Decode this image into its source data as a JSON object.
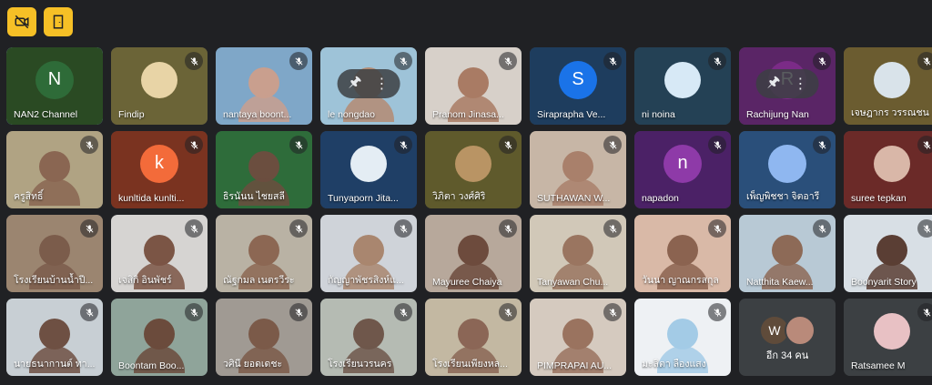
{
  "toolbar": {
    "buttons": [
      {
        "icon": "camera-off-icon",
        "color": "#f6c026"
      },
      {
        "icon": "leave-room-icon",
        "color": "#f6c026"
      }
    ]
  },
  "participants": [
    {
      "name": "NAN2 Channel",
      "type": "avatar",
      "initial": "N",
      "avatar_color": "#2e6b38",
      "bg": "#2a4a23",
      "mic": "on",
      "active": true
    },
    {
      "name": "Findip",
      "type": "avatar-img",
      "avatar_color": "#e8d4a6",
      "bg": "#6b6437",
      "mic": "muted"
    },
    {
      "name": "nantaya boont...",
      "type": "video",
      "bg": "#7fa7c8",
      "person": "#c99f8e",
      "mic": "muted"
    },
    {
      "name": "le nongdao",
      "type": "video",
      "bg": "#9ec3d8",
      "person": "#b48b73",
      "mic": "muted",
      "hover": true
    },
    {
      "name": "Pranom Jinasa...",
      "type": "video",
      "bg": "#d7d0c9",
      "person": "#a97b64",
      "mic": "muted"
    },
    {
      "name": "Siraprapha Ve...",
      "type": "avatar",
      "initial": "S",
      "avatar_color": "#1a73e8",
      "bg": "#1e3d5e",
      "mic": "muted"
    },
    {
      "name": "ni noina",
      "type": "avatar-img",
      "avatar_color": "#d7e9f6",
      "bg": "#244155",
      "mic": "muted"
    },
    {
      "name": "Rachijung Nan",
      "type": "avatar",
      "initial": "R",
      "avatar_color": "#7b2b87",
      "bg": "#5a2566",
      "mic": "muted",
      "hover": true
    },
    {
      "name": "เจษฎากร วรรณชน",
      "type": "avatar-img",
      "avatar_color": "#d9e3ea",
      "bg": "#6b5c30",
      "mic": "muted"
    },
    {
      "name": "ครูสิทธิ์",
      "type": "video",
      "bg": "#b0a383",
      "person": "#8a6652",
      "mic": "muted"
    },
    {
      "name": "kunltida kunlti...",
      "type": "avatar",
      "initial": "k",
      "avatar_color": "#f36b3a",
      "bg": "#7a3320",
      "mic": "muted"
    },
    {
      "name": "ธิรนันน ไชยสลี",
      "type": "video",
      "bg": "#2e6c3a",
      "person": "#6b4e3f",
      "mic": "muted"
    },
    {
      "name": "Tunyaporn Jita...",
      "type": "avatar-img",
      "avatar_color": "#e4edf4",
      "bg": "#1f3f66",
      "mic": "muted"
    },
    {
      "name": "วิภิตา วงศ์ศิริ",
      "type": "avatar-img",
      "avatar_color": "#b99464",
      "bg": "#5f5a2c",
      "mic": "muted"
    },
    {
      "name": "SUTHAWAN W...",
      "type": "video",
      "bg": "#c7b6a6",
      "person": "#a9806b",
      "mic": "muted"
    },
    {
      "name": "napadon",
      "type": "avatar",
      "initial": "n",
      "avatar_color": "#8e3aa8",
      "bg": "#4b2166",
      "mic": "muted"
    },
    {
      "name": "เพ็ญพิชชา จิตอารี",
      "type": "avatar",
      "initial": "",
      "avatar_color": "#8fb7f0",
      "bg": "#2a4f7a",
      "mic": "muted"
    },
    {
      "name": "suree tepkan",
      "type": "avatar-img",
      "avatar_color": "#d9b7a8",
      "bg": "#6b2a28",
      "mic": "muted"
    },
    {
      "name": "โรงเรียนบ้านน้ำปี...",
      "type": "video",
      "bg": "#9b8570",
      "person": "#7b5c4b",
      "mic": "muted"
    },
    {
      "name": "เจสิกิ อินพัชร์",
      "type": "video",
      "bg": "#d6d4d2",
      "person": "#7b5545",
      "mic": "muted"
    },
    {
      "name": "ณัฐกมล เนตรวีระ",
      "type": "video",
      "bg": "#b9b2a4",
      "person": "#8c6753",
      "mic": "muted"
    },
    {
      "name": "กัญญาพัชรสิงห์แ...",
      "type": "video",
      "bg": "#cfd3d9",
      "person": "#a9866f",
      "mic": "muted"
    },
    {
      "name": "Mayuree Chaiya",
      "type": "video",
      "bg": "#b7a89b",
      "person": "#6d4b3d",
      "mic": "muted"
    },
    {
      "name": "Tanyawan Chu...",
      "type": "video",
      "bg": "#d1c8b8",
      "person": "#9a7560",
      "mic": "muted"
    },
    {
      "name": "วันนา ญาณกรสกุล",
      "type": "video",
      "bg": "#d9b9a7",
      "person": "#8b6350",
      "mic": "muted"
    },
    {
      "name": "Natthita Kaew...",
      "type": "video",
      "bg": "#b8c9d5",
      "person": "#8d6a57",
      "mic": "muted"
    },
    {
      "name": "Boonyarit Story",
      "type": "video",
      "bg": "#d8dfe5",
      "person": "#5a3e34",
      "mic": "muted"
    },
    {
      "name": "นายธนากานต์ ทา...",
      "type": "video",
      "bg": "#c8cfd4",
      "person": "#6e5043",
      "mic": "muted"
    },
    {
      "name": "Boontam Boo...",
      "type": "video",
      "bg": "#8fa49a",
      "person": "#6b4b3c",
      "mic": "muted"
    },
    {
      "name": "วศินี ยอดเดชะ",
      "type": "video",
      "bg": "#a09a93",
      "person": "#7b5a49",
      "mic": "muted"
    },
    {
      "name": "โรงเรียนวรนคร",
      "type": "video",
      "bg": "#b5bbb3",
      "person": "#6f574b",
      "mic": "muted"
    },
    {
      "name": "โรงเรียนเพียงหล...",
      "type": "video",
      "bg": "#c3b8a2",
      "person": "#8b6656",
      "mic": "muted"
    },
    {
      "name": "PIMPRAPAI AU...",
      "type": "video",
      "bg": "#d5cabf",
      "person": "#9a735f",
      "mic": "muted"
    },
    {
      "name": "มะลิตา ลืองแสง",
      "type": "video",
      "bg": "#eef1f4",
      "person": "#a3cbe6",
      "mic": "muted"
    },
    {
      "name": "อีก 34 คน",
      "type": "more",
      "mic": "none"
    },
    {
      "name": "Ratsamee M",
      "type": "avatar-img",
      "avatar_color": "#e8c1c4",
      "bg": "#3c4043",
      "mic": "muted"
    }
  ],
  "more": {
    "initial": "W",
    "initial_color": "#5f4b3a",
    "second_color": "#b98a7a"
  }
}
